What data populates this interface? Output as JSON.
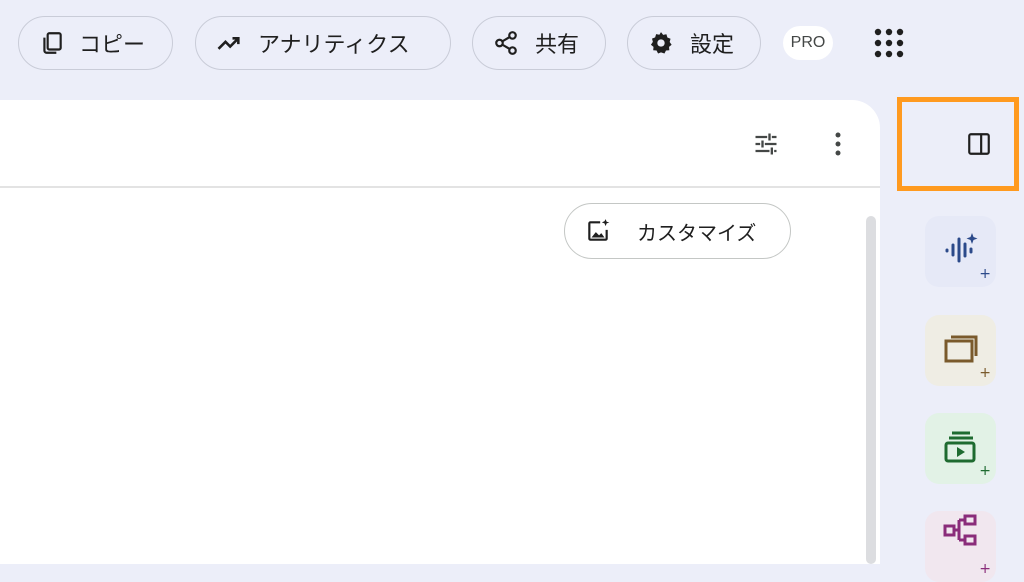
{
  "toolbar": {
    "copy_label": "コピー",
    "analytics_label": "アナリティクス",
    "share_label": "共有",
    "settings_label": "設定",
    "pro_badge": "PRO"
  },
  "content": {
    "customize_label": "カスタマイズ"
  },
  "side_tools": {
    "tiles": [
      {
        "icon": "audio-sparkle-icon",
        "plus": "+",
        "bg": "#e6e9f7",
        "color": "#2c4a8a"
      },
      {
        "icon": "flashcards-icon",
        "plus": "+",
        "bg": "#efede4",
        "color": "#7a5a2c"
      },
      {
        "icon": "video-overview-icon",
        "plus": "+",
        "bg": "#e2f2e6",
        "color": "#1e6b30"
      },
      {
        "icon": "mind-map-icon",
        "plus": "+",
        "bg": "#f1e7ef",
        "color": "#8a2c7a"
      }
    ]
  },
  "colors": {
    "background": "#eceef9",
    "highlight": "#ff9a1f"
  }
}
